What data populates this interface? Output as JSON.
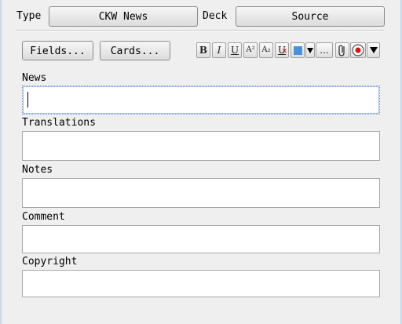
{
  "header": {
    "type_label": "Type",
    "type_value": "CKW News",
    "deck_label": "Deck",
    "deck_value": "Source"
  },
  "toolbar": {
    "fields_button": "Fields...",
    "cards_button": "Cards...",
    "bold": "B",
    "italic": "I",
    "underline": "U",
    "superscript": "A²",
    "subscript": "A₂",
    "clear_format": "U",
    "more": "...",
    "text_color": "#4a90e0"
  },
  "fields": [
    {
      "label": "News",
      "value": ""
    },
    {
      "label": "Translations",
      "value": ""
    },
    {
      "label": "Notes",
      "value": ""
    },
    {
      "label": "Comment",
      "value": ""
    },
    {
      "label": "Copyright",
      "value": ""
    }
  ]
}
